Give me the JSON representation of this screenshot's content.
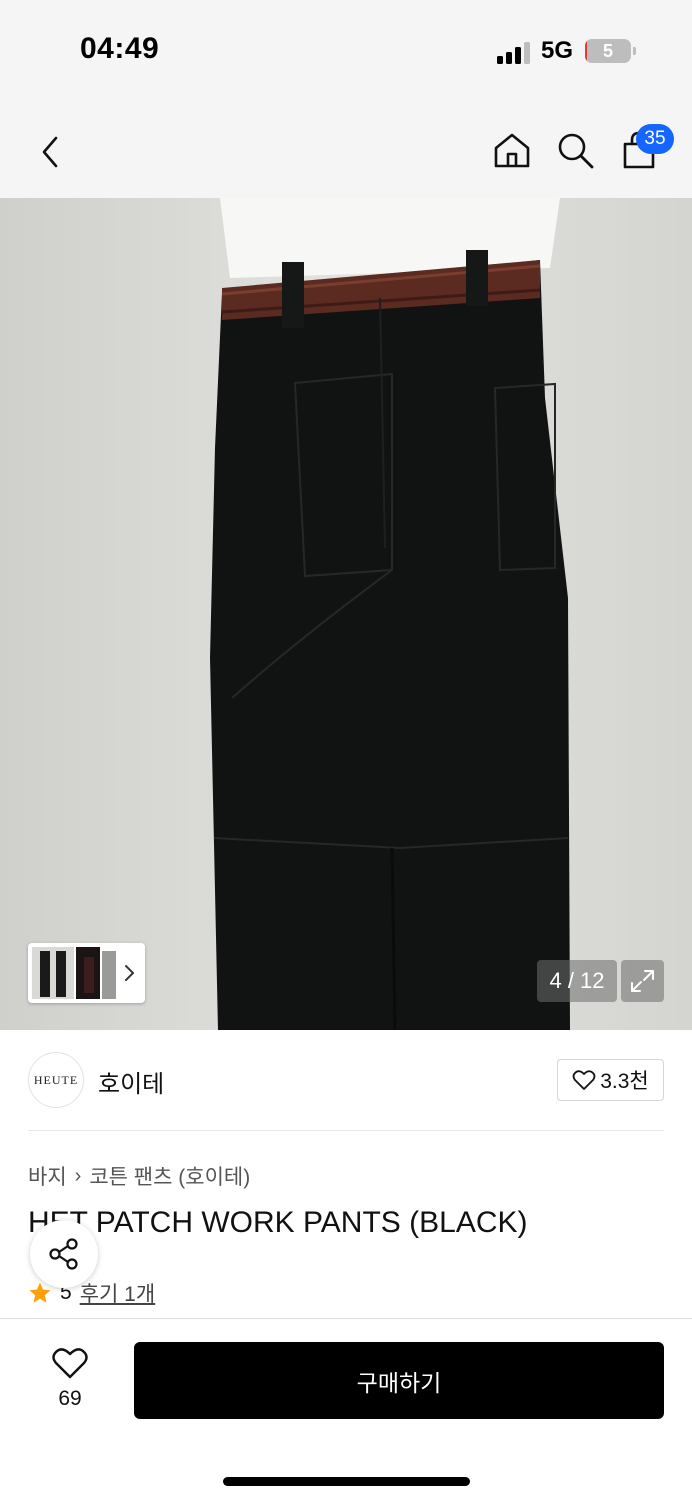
{
  "status_bar": {
    "time": "04:49",
    "network": "5G",
    "battery_level": "5",
    "battery_percent": 5,
    "battery_color": "#e53935"
  },
  "header": {
    "back_icon": "chevron-left-icon",
    "home_icon": "home-icon",
    "search_icon": "search-icon",
    "cart_icon": "shopping-bag-icon",
    "cart_count": "35",
    "badge_color": "#1565ff"
  },
  "gallery": {
    "current": "4",
    "total": "12",
    "counter_text": "4 / 12",
    "expand_icon": "expand-icon"
  },
  "brand": {
    "logo_text": "HEUTE",
    "name": "호이테",
    "favorites": "3.3천"
  },
  "product": {
    "breadcrumb": [
      "바지",
      "코튼 팬츠 (호이테)"
    ],
    "title": "HET PATCH WORK PANTS (BLACK)",
    "rating": "5",
    "review_text": "후기 1개"
  },
  "bottom_bar": {
    "like_count": "69",
    "buy_label": "구매하기"
  }
}
